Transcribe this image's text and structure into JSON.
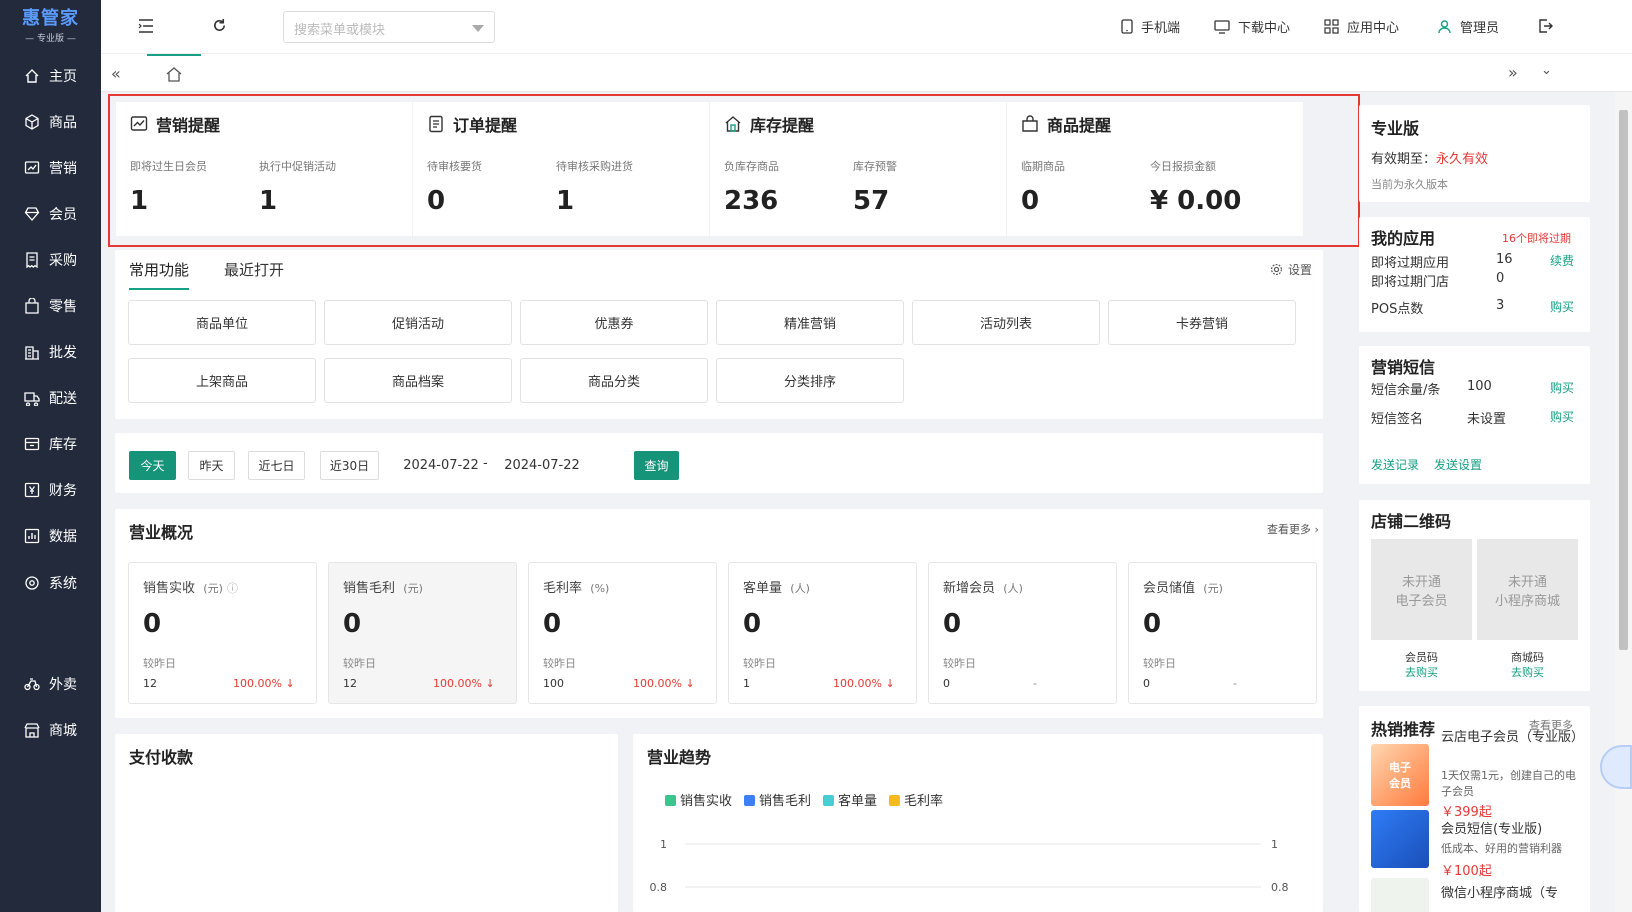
{
  "brand": {
    "name": "惠管家",
    "edition": "— 专业版 —"
  },
  "sidebar": {
    "items": [
      {
        "label": "主页",
        "icon": "home-icon"
      },
      {
        "label": "商品",
        "icon": "cube-icon"
      },
      {
        "label": "营销",
        "icon": "chart-icon"
      },
      {
        "label": "会员",
        "icon": "diamond-icon"
      },
      {
        "label": "采购",
        "icon": "receipt-icon"
      },
      {
        "label": "零售",
        "icon": "bag-icon"
      },
      {
        "label": "批发",
        "icon": "building-icon"
      },
      {
        "label": "配送",
        "icon": "truck-icon"
      },
      {
        "label": "库存",
        "icon": "box-icon"
      },
      {
        "label": "财务",
        "icon": "yen-icon"
      },
      {
        "label": "数据",
        "icon": "bar-chart-icon"
      },
      {
        "label": "系统",
        "icon": "settings-icon"
      },
      {
        "label": "外卖",
        "icon": "bike-icon"
      },
      {
        "label": "商城",
        "icon": "store-icon"
      }
    ]
  },
  "topbar": {
    "search_placeholder": "搜索菜单或模块",
    "mobile": "手机端",
    "download": "下载中心",
    "apps": "应用中心",
    "user": "管理员"
  },
  "reminders": [
    {
      "title": "营销提醒",
      "l1": "即将过生日会员",
      "v1": "1",
      "l2": "执行中促销活动",
      "v2": "1"
    },
    {
      "title": "订单提醒",
      "l1": "待审核要货",
      "v1": "0",
      "l2": "待审核采购进货",
      "v2": "1"
    },
    {
      "title": "库存提醒",
      "l1": "负库存商品",
      "v1": "236",
      "l2": "库存预警",
      "v2": "57"
    },
    {
      "title": "商品提醒",
      "l1": "临期商品",
      "v1": "0",
      "l2": "今日报损金额",
      "v2": "¥ 0.00"
    }
  ],
  "functions": {
    "tab_active": "常用功能",
    "tab_other": "最近打开",
    "settings": "设置",
    "buttons": [
      "商品单位",
      "促销活动",
      "优惠券",
      "精准营销",
      "活动列表",
      "卡券营销",
      "上架商品",
      "商品档案",
      "商品分类",
      "分类排序"
    ]
  },
  "date_filter": {
    "today": "今天",
    "yesterday": "昨天",
    "week": "近七日",
    "month": "近30日",
    "start": "2024-07-22",
    "sep": "-",
    "end": "2024-07-22",
    "query": "查询"
  },
  "overview": {
    "title": "营业概况",
    "more": "查看更多",
    "metrics": [
      {
        "name": "销售实收",
        "unit": "(元)",
        "value": "0",
        "cmp": "较昨日",
        "prev": "12",
        "pct": "100.00% ↓"
      },
      {
        "name": "销售毛利",
        "unit": "(元)",
        "value": "0",
        "cmp": "较昨日",
        "prev": "12",
        "pct": "100.00% ↓"
      },
      {
        "name": "毛利率",
        "unit": "(%)",
        "value": "0",
        "cmp": "较昨日",
        "prev": "100",
        "pct": "100.00% ↓"
      },
      {
        "name": "客单量",
        "unit": "(人)",
        "value": "0",
        "cmp": "较昨日",
        "prev": "1",
        "pct": "100.00% ↓"
      },
      {
        "name": "新增会员",
        "unit": "(人)",
        "value": "0",
        "cmp": "较昨日",
        "prev": "0",
        "pct": "-"
      },
      {
        "name": "会员储值",
        "unit": "(元)",
        "value": "0",
        "cmp": "较昨日",
        "prev": "0",
        "pct": "-"
      }
    ]
  },
  "payment": {
    "title": "支付收款"
  },
  "trend": {
    "title": "营业趋势",
    "chart_data": {
      "type": "line",
      "series": [
        {
          "name": "销售实收",
          "color": "#3cc48f"
        },
        {
          "name": "销售毛利",
          "color": "#3d7ff5"
        },
        {
          "name": "客单量",
          "color": "#46cfd3"
        },
        {
          "name": "毛利率",
          "color": "#f5b921"
        }
      ],
      "y_left_ticks": [
        "1",
        "0.8"
      ],
      "y_right_ticks": [
        "1",
        "0.8"
      ]
    }
  },
  "pro": {
    "title": "专业版",
    "valid_label": "有效期至：",
    "valid_value": "永久有效",
    "note": "当前为永久版本"
  },
  "myapps": {
    "title": "我的应用",
    "warn": "16个即将过期",
    "rows": [
      {
        "k": "即将过期应用",
        "v": "16",
        "a": "续费"
      },
      {
        "k": "即将过期门店",
        "v": "0",
        "a": ""
      },
      {
        "k": "POS点数",
        "v": "3",
        "a": "购买"
      }
    ]
  },
  "sms": {
    "title": "营销短信",
    "rows": [
      {
        "k": "短信余量/条",
        "v": "100",
        "a": "购买"
      },
      {
        "k": "短信签名",
        "v": "未设置",
        "a": "购买"
      }
    ],
    "link1": "发送记录",
    "link2": "发送设置"
  },
  "qr": {
    "title": "店铺二维码",
    "q1_line1": "未开通",
    "q1_line2": "电子会员",
    "q1_label": "会员码",
    "q1_action": "去购买",
    "q2_line1": "未开通",
    "q2_line2": "小程序商城",
    "q2_label": "商城码",
    "q2_action": "去购买"
  },
  "hot": {
    "title": "热销推荐",
    "more": "查看更多",
    "items": [
      {
        "name": "云店电子会员（专业版）",
        "desc": "1天仅需1元，创建自己的电子会员",
        "price": "￥399起"
      },
      {
        "name": "会员短信(专业版)",
        "desc": "低成本、好用的营销利器",
        "price": "￥100起"
      },
      {
        "name": "微信小程序商城（专",
        "desc": "",
        "price": ""
      }
    ]
  }
}
